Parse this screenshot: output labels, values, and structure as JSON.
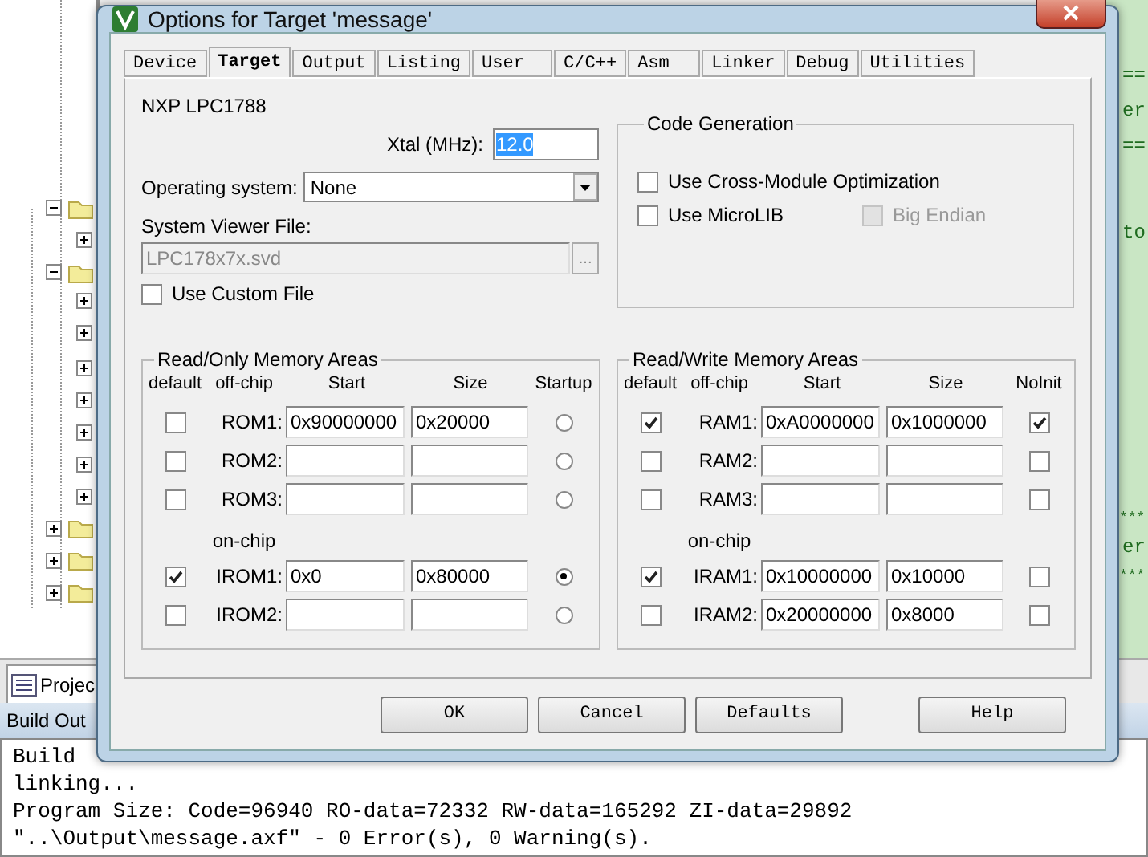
{
  "editor": {
    "lines": [
      "==",
      "er",
      "==",
      "to",
      "***",
      "er",
      "***"
    ]
  },
  "panel_tabs": [
    {
      "label": "Projec",
      "selected": true
    }
  ],
  "output": {
    "title": "Build Out",
    "lines": [
      "Build",
      "linking...",
      "Program Size: Code=96940 RO-data=72332 RW-data=165292 ZI-data=29892",
      "\"..\\Output\\message.axf\" - 0 Error(s), 0 Warning(s)."
    ]
  },
  "dialog": {
    "title": "Options for Target 'message'",
    "tabs": [
      {
        "label": "Device",
        "selected": false
      },
      {
        "label": "Target",
        "selected": true
      },
      {
        "label": "Output",
        "selected": false
      },
      {
        "label": "Listing",
        "selected": false
      },
      {
        "label": "User",
        "selected": false
      },
      {
        "label": "C/C++",
        "selected": false
      },
      {
        "label": "Asm",
        "selected": false
      },
      {
        "label": "Linker",
        "selected": false
      },
      {
        "label": "Debug",
        "selected": false
      },
      {
        "label": "Utilities",
        "selected": false
      }
    ],
    "device": "NXP LPC1788",
    "xtal": {
      "label": "Xtal (MHz):",
      "value": "12.0"
    },
    "os": {
      "label": "Operating system:",
      "value": "None"
    },
    "svf": {
      "label": "System Viewer File:",
      "value": "LPC178x7x.svd",
      "disabled": true,
      "browse": "..."
    },
    "use_custom_file": {
      "label": "Use Custom File",
      "checked": false
    },
    "code_generation": {
      "title": "Code Generation",
      "options": [
        {
          "label": "Use Cross-Module Optimization",
          "checked": false,
          "disabled": false
        },
        {
          "label": "Use MicroLIB",
          "checked": false,
          "disabled": false
        },
        {
          "label": "Big Endian",
          "checked": false,
          "disabled": true
        }
      ]
    },
    "memory": [
      {
        "kind": "rom",
        "title": "Read/Only Memory Areas",
        "headers": [
          "default",
          "off-chip",
          "Start",
          "Size",
          "Startup"
        ],
        "section": "on-chip",
        "rows": [
          {
            "default": false,
            "name": "ROM1:",
            "start": "0x90000000",
            "size": "0x20000",
            "flag": false
          },
          {
            "default": false,
            "name": "ROM2:",
            "start": "",
            "size": "",
            "flag": false
          },
          {
            "default": false,
            "name": "ROM3:",
            "start": "",
            "size": "",
            "flag": false
          },
          {
            "default": true,
            "name": "IROM1:",
            "start": "0x0",
            "size": "0x80000",
            "flag": true
          },
          {
            "default": false,
            "name": "IROM2:",
            "start": "",
            "size": "",
            "flag": false
          }
        ]
      },
      {
        "kind": "ram",
        "title": "Read/Write Memory Areas",
        "headers": [
          "default",
          "off-chip",
          "Start",
          "Size",
          "NoInit"
        ],
        "section": "on-chip",
        "rows": [
          {
            "default": true,
            "name": "RAM1:",
            "start": "0xA0000000",
            "size": "0x1000000",
            "flag": true
          },
          {
            "default": false,
            "name": "RAM2:",
            "start": "",
            "size": "",
            "flag": false
          },
          {
            "default": false,
            "name": "RAM3:",
            "start": "",
            "size": "",
            "flag": false
          },
          {
            "default": true,
            "name": "IRAM1:",
            "start": "0x10000000",
            "size": "0x10000",
            "flag": false
          },
          {
            "default": false,
            "name": "IRAM2:",
            "start": "0x20000000",
            "size": "0x8000",
            "flag": false
          }
        ]
      }
    ],
    "buttons": [
      "OK",
      "Cancel",
      "Defaults"
    ],
    "help_button": "Help"
  }
}
